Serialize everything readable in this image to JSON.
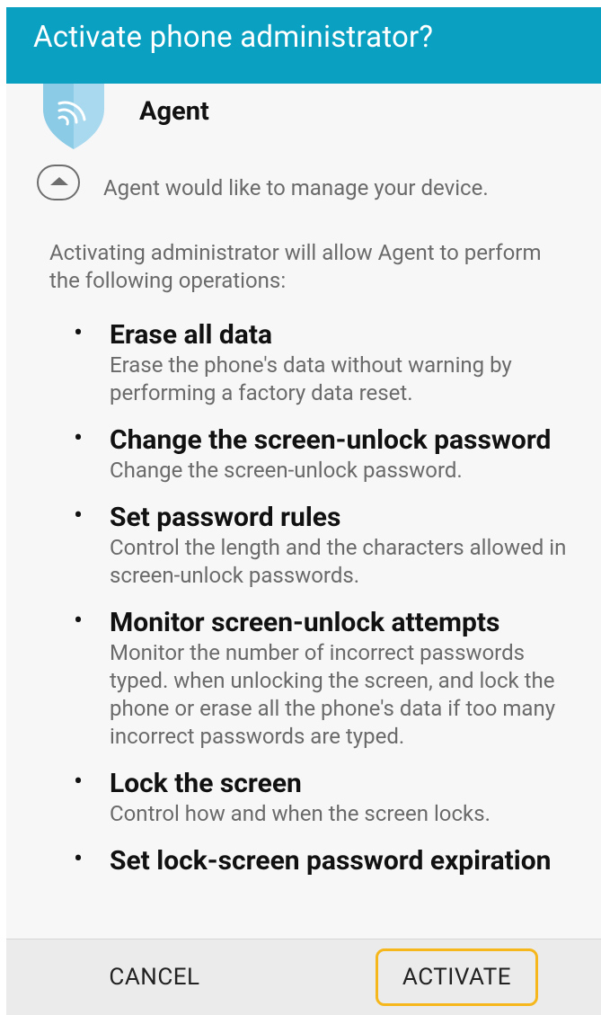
{
  "dialog": {
    "title": "Activate phone administrator?"
  },
  "app": {
    "name": "Agent",
    "icon": "shield-wifi-icon",
    "manage_text": "Agent would like to manage your device."
  },
  "intro_text": "Activating administrator will allow Agent to perform the following operations:",
  "operations": [
    {
      "title": "Erase all data",
      "desc": "Erase the phone's data without warning by performing a factory data reset."
    },
    {
      "title": "Change the screen-unlock password",
      "desc": "Change the screen-unlock password."
    },
    {
      "title": "Set password rules",
      "desc": "Control the length and the characters allowed in screen-unlock passwords."
    },
    {
      "title": "Monitor screen-unlock attempts",
      "desc": "Monitor the number of incorrect passwords typed. when unlocking the screen, and lock the phone or erase all the phone's data if too many incorrect passwords are typed."
    },
    {
      "title": "Lock the screen",
      "desc": "Control how and when the screen locks."
    },
    {
      "title": "Set lock-screen password expiration",
      "desc": ""
    }
  ],
  "buttons": {
    "cancel": "CANCEL",
    "activate": "ACTIVATE"
  },
  "colors": {
    "header": "#0aa0c2",
    "highlight": "#f5b71c",
    "shield": "#a9d9ef"
  }
}
